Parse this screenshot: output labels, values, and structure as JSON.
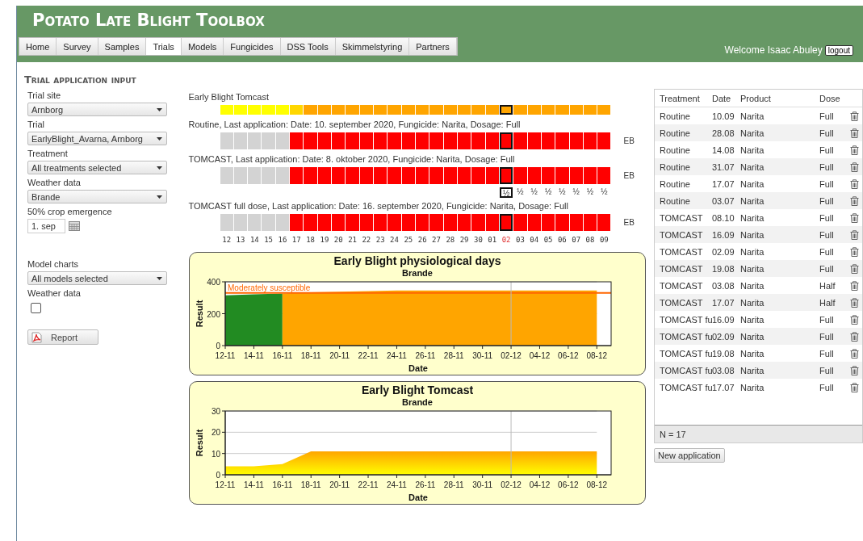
{
  "header": {
    "title": "Potato Late Blight Toolbox",
    "welcome": "Welcome Isaac Abuley",
    "logout": "logout"
  },
  "nav": [
    {
      "label": "Home",
      "selected": false
    },
    {
      "label": "Survey",
      "selected": false
    },
    {
      "label": "Samples",
      "selected": false
    },
    {
      "label": "Trials",
      "selected": true
    },
    {
      "label": "Models",
      "selected": false
    },
    {
      "label": "Fungicides",
      "selected": false
    },
    {
      "label": "DSS Tools",
      "selected": false
    },
    {
      "label": "Skimmelstyring",
      "selected": false
    },
    {
      "label": "Partners",
      "selected": false
    }
  ],
  "page_title": "Trial application input",
  "form": {
    "sections": [
      {
        "fields": [
          {
            "kind": "select",
            "label": "Trial site",
            "value": "Arnborg"
          },
          {
            "kind": "select",
            "label": "Trial",
            "value": "EarlyBlight_Avarna, Arnborg"
          },
          {
            "kind": "select",
            "label": "Treatment",
            "value": "All treatments selected"
          },
          {
            "kind": "select",
            "label": "Weather data",
            "value": "Brande"
          },
          {
            "kind": "date",
            "label": "50% crop emergence",
            "value": "1. sep"
          }
        ]
      },
      {
        "fields": [
          {
            "kind": "select",
            "label": "Model charts",
            "value": "All models selected"
          },
          {
            "kind": "checkbox",
            "label": "Weather data",
            "checked": false
          }
        ]
      }
    ],
    "report_button": "Report"
  },
  "grid_rows": [
    {
      "kind": "model",
      "label": "Early Blight Tomcast",
      "cells": [
        {
          "color": "#ffff00"
        },
        {
          "color": "#ffff00"
        },
        {
          "color": "#ffff00"
        },
        {
          "color": "#ffff00"
        },
        {
          "color": "#ffff00"
        },
        {
          "color": "#ffd700"
        },
        {
          "color": "#ffa500"
        },
        {
          "color": "#ffa500"
        },
        {
          "color": "#ffa500"
        },
        {
          "color": "#ffa500"
        },
        {
          "color": "#ffa500"
        },
        {
          "color": "#ffa500"
        },
        {
          "color": "#ffa500"
        },
        {
          "color": "#ffa500"
        },
        {
          "color": "#ffa500"
        },
        {
          "color": "#ffa500"
        },
        {
          "color": "#ffa500"
        },
        {
          "color": "#ffa500"
        },
        {
          "color": "#ffa500"
        },
        {
          "color": "#ffa500"
        },
        {
          "color": "#ffa500"
        },
        {
          "color": "#ffa500"
        },
        {
          "color": "#ffa500"
        },
        {
          "color": "#ffa500"
        },
        {
          "color": "#ffa500"
        },
        {
          "color": "#ffa500"
        },
        {
          "color": "#ffa500"
        },
        {
          "color": "#ffa500"
        }
      ]
    },
    {
      "kind": "treatment",
      "label": "Routine, Last application: Date: 10. september 2020, Fungicide: Narita, Dosage: Full",
      "tag": "EB",
      "cells": [
        {
          "color": "#d3d3d3"
        },
        {
          "color": "#d3d3d3"
        },
        {
          "color": "#d3d3d3"
        },
        {
          "color": "#d3d3d3"
        },
        {
          "color": "#d3d3d3"
        },
        {
          "color": "#ff0000"
        },
        {
          "color": "#ff0000"
        },
        {
          "color": "#ff0000"
        },
        {
          "color": "#ff0000"
        },
        {
          "color": "#ff0000"
        },
        {
          "color": "#ff0000"
        },
        {
          "color": "#ff0000"
        },
        {
          "color": "#ff0000"
        },
        {
          "color": "#ff0000"
        },
        {
          "color": "#ff0000"
        },
        {
          "color": "#ff0000"
        },
        {
          "color": "#ff0000"
        },
        {
          "color": "#ff0000"
        },
        {
          "color": "#ff0000"
        },
        {
          "color": "#ff0000"
        },
        {
          "color": "#ff0000"
        },
        {
          "color": "#ff0000"
        },
        {
          "color": "#ff0000"
        },
        {
          "color": "#ff0000"
        },
        {
          "color": "#ff0000"
        },
        {
          "color": "#ff0000"
        },
        {
          "color": "#ff0000"
        },
        {
          "color": "#ff0000"
        }
      ]
    },
    {
      "kind": "treatment",
      "label": "TOMCAST, Last application: Date: 8. oktober 2020, Fungicide: Narita, Dosage: Full",
      "tag": "EB",
      "cells": [
        {
          "color": "#d3d3d3"
        },
        {
          "color": "#d3d3d3"
        },
        {
          "color": "#d3d3d3"
        },
        {
          "color": "#d3d3d3"
        },
        {
          "color": "#d3d3d3"
        },
        {
          "color": "#ff0000"
        },
        {
          "color": "#ff0000"
        },
        {
          "color": "#ff0000"
        },
        {
          "color": "#ff0000"
        },
        {
          "color": "#ff0000"
        },
        {
          "color": "#ff0000"
        },
        {
          "color": "#ff0000"
        },
        {
          "color": "#ff0000"
        },
        {
          "color": "#ff0000"
        },
        {
          "color": "#ff0000"
        },
        {
          "color": "#ff0000"
        },
        {
          "color": "#ff0000"
        },
        {
          "color": "#ff0000"
        },
        {
          "color": "#ff0000"
        },
        {
          "color": "#ff0000"
        },
        {
          "color": "#ff0000"
        },
        {
          "color": "#ff0000"
        },
        {
          "color": "#ff0000"
        },
        {
          "color": "#ff0000"
        },
        {
          "color": "#ff0000"
        },
        {
          "color": "#ff0000"
        },
        {
          "color": "#ff0000"
        },
        {
          "color": "#ff0000"
        }
      ],
      "dose_marks": [
        {
          "text": "½",
          "selected": true
        },
        {
          "text": "½",
          "selected": false
        },
        {
          "text": "½",
          "selected": false
        },
        {
          "text": "½",
          "selected": false
        },
        {
          "text": "½",
          "selected": false
        },
        {
          "text": "½",
          "selected": false
        },
        {
          "text": "½",
          "selected": false
        },
        {
          "text": "½",
          "selected": false
        }
      ]
    },
    {
      "kind": "treatment",
      "label": "TOMCAST full dose, Last application: Date: 16. september 2020, Fungicide: Narita, Dosage: Full",
      "tag": "EB",
      "cells": [
        {
          "color": "#d3d3d3"
        },
        {
          "color": "#d3d3d3"
        },
        {
          "color": "#d3d3d3"
        },
        {
          "color": "#d3d3d3"
        },
        {
          "color": "#d3d3d3"
        },
        {
          "color": "#ff0000"
        },
        {
          "color": "#ff0000"
        },
        {
          "color": "#ff0000"
        },
        {
          "color": "#ff0000"
        },
        {
          "color": "#ff0000"
        },
        {
          "color": "#ff0000"
        },
        {
          "color": "#ff0000"
        },
        {
          "color": "#ff0000"
        },
        {
          "color": "#ff0000"
        },
        {
          "color": "#ff0000"
        },
        {
          "color": "#ff0000"
        },
        {
          "color": "#ff0000"
        },
        {
          "color": "#ff0000"
        },
        {
          "color": "#ff0000"
        },
        {
          "color": "#ff0000"
        },
        {
          "color": "#ff0000"
        },
        {
          "color": "#ff0000"
        },
        {
          "color": "#ff0000"
        },
        {
          "color": "#ff0000"
        },
        {
          "color": "#ff0000"
        },
        {
          "color": "#ff0000"
        },
        {
          "color": "#ff0000"
        },
        {
          "color": "#ff0000"
        }
      ]
    }
  ],
  "days": [
    {
      "label": "12",
      "today": false
    },
    {
      "label": "13",
      "today": false
    },
    {
      "label": "14",
      "today": false
    },
    {
      "label": "15",
      "today": false
    },
    {
      "label": "16",
      "today": false
    },
    {
      "label": "17",
      "today": false
    },
    {
      "label": "18",
      "today": false
    },
    {
      "label": "19",
      "today": false
    },
    {
      "label": "20",
      "today": false
    },
    {
      "label": "21",
      "today": false
    },
    {
      "label": "22",
      "today": false
    },
    {
      "label": "23",
      "today": false
    },
    {
      "label": "24",
      "today": false
    },
    {
      "label": "25",
      "today": false
    },
    {
      "label": "26",
      "today": false
    },
    {
      "label": "27",
      "today": false
    },
    {
      "label": "28",
      "today": false
    },
    {
      "label": "29",
      "today": false
    },
    {
      "label": "30",
      "today": false
    },
    {
      "label": "01",
      "today": false
    },
    {
      "label": "02",
      "today": true
    },
    {
      "label": "03",
      "today": false
    },
    {
      "label": "04",
      "today": false
    },
    {
      "label": "05",
      "today": false
    },
    {
      "label": "06",
      "today": false
    },
    {
      "label": "07",
      "today": false
    },
    {
      "label": "08",
      "today": false
    },
    {
      "label": "09",
      "today": false
    }
  ],
  "charts": [
    {
      "chart_data": {
        "type": "area",
        "title": "Early Blight physiological days",
        "subtitle": "Brande",
        "xlabel": "Date",
        "ylabel": "Result",
        "categories": [
          "12-11",
          "14-11",
          "16-11",
          "18-11",
          "20-11",
          "22-11",
          "24-11",
          "26-11",
          "28-11",
          "30-11",
          "02-12",
          "04-12",
          "06-12",
          "08-12"
        ],
        "series": [
          {
            "color": "#228b22",
            "values": [
              315,
              321,
              326,
              null,
              null,
              null,
              null,
              null,
              null,
              null,
              null,
              null,
              null,
              null
            ]
          },
          {
            "color": "#ffa500",
            "values": [
              null,
              null,
              326,
              334,
              338,
              342,
              345,
              346,
              346,
              346,
              346,
              346,
              346,
              346
            ]
          }
        ],
        "ylim": [
          0,
          400
        ],
        "yticks": [
          0,
          200,
          400
        ],
        "ref_lines": [
          {
            "axis": "y",
            "value": 330,
            "label": "Moderately susceptible"
          },
          {
            "axis": "x",
            "value": "02-12"
          }
        ]
      }
    },
    {
      "chart_data": {
        "type": "area",
        "title": "Early Blight Tomcast",
        "subtitle": "Brande",
        "xlabel": "Date",
        "ylabel": "Result",
        "categories": [
          "12-11",
          "14-11",
          "16-11",
          "18-11",
          "20-11",
          "22-11",
          "24-11",
          "26-11",
          "28-11",
          "30-11",
          "02-12",
          "04-12",
          "06-12",
          "08-12"
        ],
        "series": [
          {
            "color": "#ffa500",
            "values": [
              4,
              4,
              5,
              11,
              11,
              11,
              11,
              11,
              11,
              11,
              11,
              11,
              11,
              11
            ]
          }
        ],
        "ylim": [
          0,
          30
        ],
        "yticks": [
          0,
          10,
          20,
          30
        ],
        "ref_lines": [
          {
            "axis": "x",
            "value": "02-12"
          }
        ]
      }
    }
  ],
  "applications": {
    "columns": [
      "Treatment",
      "Date",
      "Product",
      "Dose"
    ],
    "rows": [
      [
        "Routine",
        "10.09",
        "Narita",
        "Full"
      ],
      [
        "Routine",
        "28.08",
        "Narita",
        "Full"
      ],
      [
        "Routine",
        "14.08",
        "Narita",
        "Full"
      ],
      [
        "Routine",
        "31.07",
        "Narita",
        "Full"
      ],
      [
        "Routine",
        "17.07",
        "Narita",
        "Full"
      ],
      [
        "Routine",
        "03.07",
        "Narita",
        "Full"
      ],
      [
        "TOMCAST",
        "08.10",
        "Narita",
        "Full"
      ],
      [
        "TOMCAST",
        "16.09",
        "Narita",
        "Full"
      ],
      [
        "TOMCAST",
        "02.09",
        "Narita",
        "Full"
      ],
      [
        "TOMCAST",
        "19.08",
        "Narita",
        "Full"
      ],
      [
        "TOMCAST",
        "03.08",
        "Narita",
        "Half"
      ],
      [
        "TOMCAST",
        "17.07",
        "Narita",
        "Half"
      ],
      [
        "TOMCAST fu",
        "16.09",
        "Narita",
        "Full"
      ],
      [
        "TOMCAST fu",
        "02.09",
        "Narita",
        "Full"
      ],
      [
        "TOMCAST fu",
        "19.08",
        "Narita",
        "Full"
      ],
      [
        "TOMCAST fu",
        "03.08",
        "Narita",
        "Full"
      ],
      [
        "TOMCAST fu",
        "17.07",
        "Narita",
        "Full"
      ]
    ],
    "footer": "N = 17",
    "new_button": "New application"
  }
}
